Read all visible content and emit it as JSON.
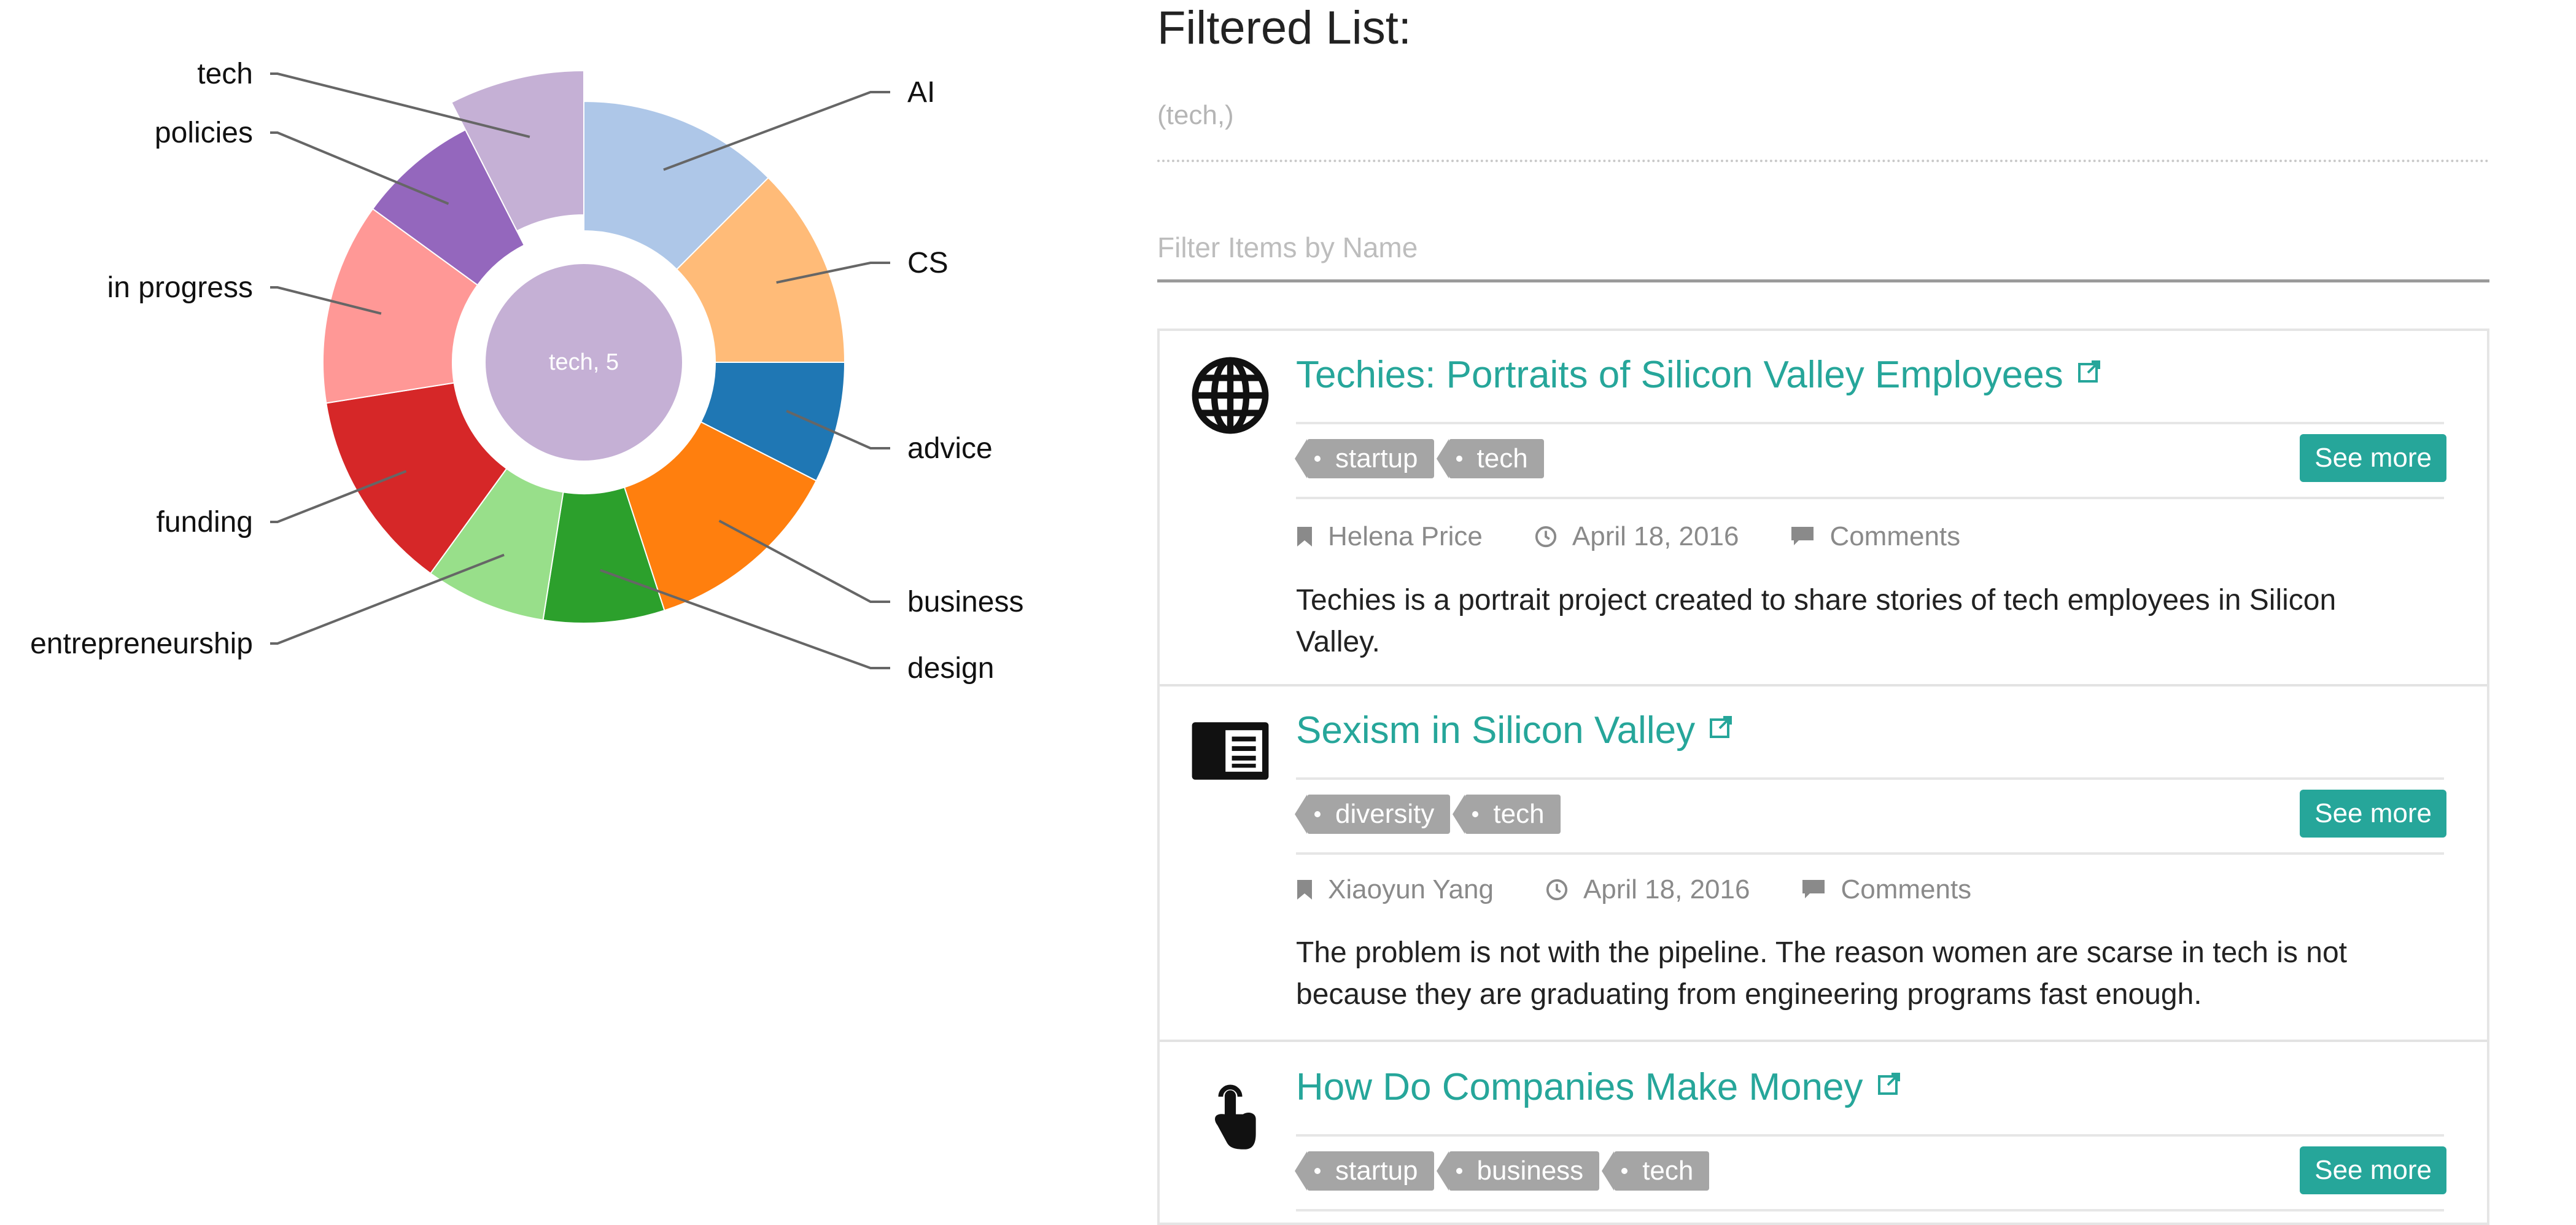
{
  "chart_data": {
    "type": "sunburst",
    "center_label": "tech, 5",
    "selected_segment": "tech",
    "segments": [
      {
        "label": "AI",
        "value": 1,
        "color": "#aec7e8"
      },
      {
        "label": "CS",
        "value": 1,
        "color": "#ffbb78"
      },
      {
        "label": "advice",
        "value": 0.6,
        "color": "#1f77b4"
      },
      {
        "label": "business",
        "value": 1,
        "color": "#ff7f0e"
      },
      {
        "label": "design",
        "value": 0.6,
        "color": "#2ca02c"
      },
      {
        "label": "entrepreneurship",
        "value": 0.6,
        "color": "#98df8a"
      },
      {
        "label": "funding",
        "value": 1,
        "color": "#d62728"
      },
      {
        "label": "in progress",
        "value": 1,
        "color": "#ff9896"
      },
      {
        "label": "policies",
        "value": 0.6,
        "color": "#9467bd"
      },
      {
        "label": "tech",
        "value": 0.6,
        "color": "#c5b0d5"
      }
    ],
    "center_color": "#c5b0d5"
  },
  "filtered": {
    "title": "Filtered List:",
    "selection": "(tech,)",
    "filter_placeholder": "Filter Items by Name"
  },
  "items": [
    {
      "icon": "globe-icon",
      "title": "Techies: Portraits of Silicon Valley Employees",
      "tags": [
        "startup",
        "tech"
      ],
      "see_more": "See more",
      "author": "Helena Price",
      "date": "April 18, 2016",
      "comments": "Comments",
      "description": "Techies is a portrait project created to share stories of tech employees in Silicon Valley."
    },
    {
      "icon": "article-icon",
      "title": "Sexism in Silicon Valley",
      "tags": [
        "diversity",
        "tech"
      ],
      "see_more": "See more",
      "author": "Xiaoyun Yang",
      "date": "April 18, 2016",
      "comments": "Comments",
      "description": "The problem is not with the pipeline. The reason women are scarse in tech is not because they are graduating from engineering programs fast enough."
    },
    {
      "icon": "touch-icon",
      "title": "How Do Companies Make Money",
      "tags": [
        "startup",
        "business",
        "tech"
      ],
      "see_more": "See more"
    }
  ],
  "colors": {
    "accent": "#26a69a",
    "tag": "#a5a5a5"
  }
}
